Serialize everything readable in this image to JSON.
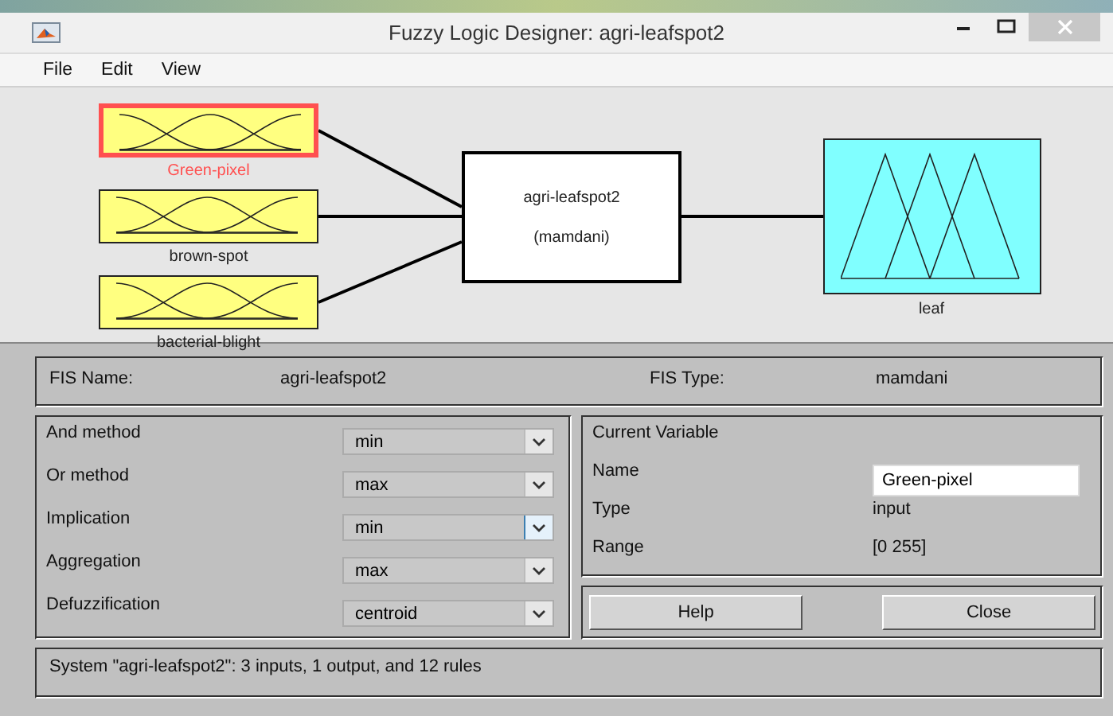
{
  "window": {
    "title": "Fuzzy Logic Designer: agri-leafspot2"
  },
  "menu": [
    "File",
    "Edit",
    "View"
  ],
  "diagram": {
    "inputs": [
      {
        "name": "Green-pixel",
        "selected": true
      },
      {
        "name": "brown-spot",
        "selected": false
      },
      {
        "name": "bacterial-blight",
        "selected": false
      }
    ],
    "system": {
      "name": "agri-leafspot2",
      "type": "(mamdani)"
    },
    "outputs": [
      {
        "name": "leaf",
        "selected": false
      }
    ]
  },
  "fis": {
    "name_label": "FIS Name:",
    "name": "agri-leafspot2",
    "type_label": "FIS Type:",
    "type": "mamdani"
  },
  "methods": [
    {
      "label": "And method",
      "value": "min",
      "highlighted": false
    },
    {
      "label": "Or method",
      "value": "max",
      "highlighted": false
    },
    {
      "label": "Implication",
      "value": "min",
      "highlighted": true
    },
    {
      "label": "Aggregation",
      "value": "max",
      "highlighted": false
    },
    {
      "label": "Defuzzification",
      "value": "centroid",
      "highlighted": false
    }
  ],
  "current_variable": {
    "title": "Current Variable",
    "name_label": "Name",
    "name": "Green-pixel",
    "type_label": "Type",
    "type": "input",
    "range_label": "Range",
    "range": "[0 255]"
  },
  "buttons": [
    "Help",
    "Close"
  ],
  "status": "System \"agri-leafspot2\": 3 inputs, 1 output, and 12 rules"
}
